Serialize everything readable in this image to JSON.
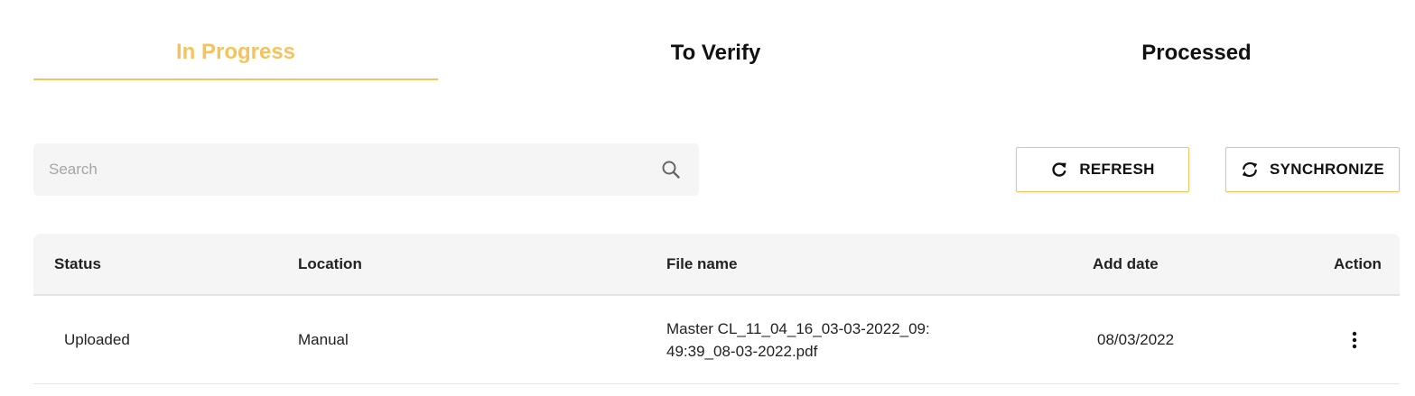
{
  "tabs": [
    {
      "label": "In Progress",
      "active": true
    },
    {
      "label": "To Verify",
      "active": false
    },
    {
      "label": "Processed",
      "active": false
    }
  ],
  "search": {
    "placeholder": "Search",
    "value": "",
    "icon": "search-icon"
  },
  "toolbar": {
    "refresh_label": "REFRESH",
    "refresh_icon": "refresh-icon",
    "synchronize_label": "SYNCHRONIZE",
    "synchronize_icon": "sync-icon"
  },
  "table": {
    "headers": [
      "Status",
      "Location",
      "File name",
      "Add date",
      "Action"
    ],
    "rows": [
      {
        "status": "Uploaded",
        "location": "Manual",
        "file_name": "Master CL_11_04_16_03-03-2022_09:49:39_08-03-2022.pdf",
        "add_date": "08/03/2022",
        "action_icon": "more-vertical-icon"
      }
    ]
  },
  "colors": {
    "accent": "#f6c35b",
    "button_border": "#f2c462",
    "surface": "#f5f5f5",
    "divider": "#e4e4e4"
  }
}
